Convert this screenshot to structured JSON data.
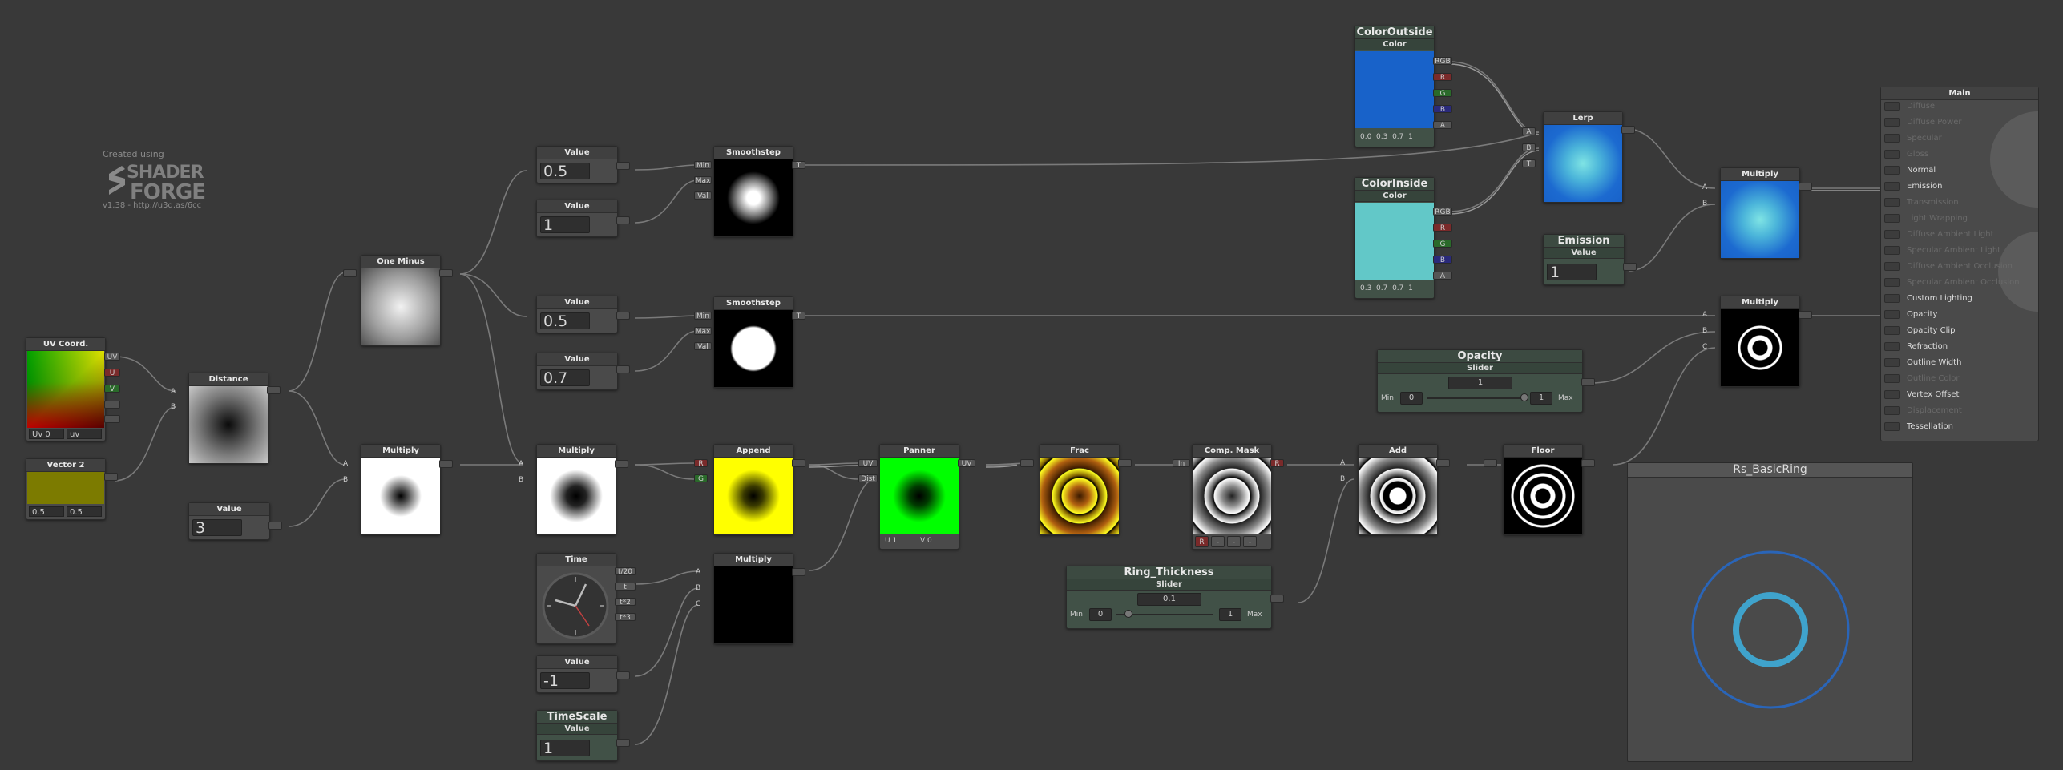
{
  "watermark": {
    "created": "Created using",
    "brand_line1": "SHADER",
    "brand_line2": "FORGE",
    "version": "v1.38 - http://u3d.as/6cc"
  },
  "nodes": {
    "uv": {
      "title": "UV Coord.",
      "ports": [
        "UV",
        "U",
        "V"
      ],
      "uv_label": "Uv 0",
      "uv_sel": "uv"
    },
    "vector2": {
      "title": "Vector 2",
      "x": "0.5",
      "y": "0.5"
    },
    "distance": {
      "title": "Distance",
      "in_a": "A",
      "in_b": "B"
    },
    "value3": {
      "title": "Value",
      "value": "3"
    },
    "oneminus": {
      "title": "One Minus"
    },
    "multiply1": {
      "title": "Multiply",
      "in_a": "A",
      "in_b": "B"
    },
    "value05a": {
      "title": "Value",
      "value": "0.5"
    },
    "value1a": {
      "title": "Value",
      "value": "1"
    },
    "value05b": {
      "title": "Value",
      "value": "0.5"
    },
    "value07": {
      "title": "Value",
      "value": "0.7"
    },
    "multiply2": {
      "title": "Multiply",
      "in_a": "A",
      "in_b": "B"
    },
    "time": {
      "title": "Time",
      "ports": [
        "t/20",
        "t",
        "t*2",
        "t*3"
      ]
    },
    "valueneg1": {
      "title": "Value",
      "value": "-1"
    },
    "timescale": {
      "title": "TimeScale",
      "sub": "Value",
      "value": "1"
    },
    "smooth1": {
      "title": "Smoothstep",
      "ins": [
        "Min",
        "Max",
        "Val"
      ],
      "out": "T"
    },
    "smooth2": {
      "title": "Smoothstep",
      "ins": [
        "Min",
        "Max",
        "Val"
      ],
      "out": "T"
    },
    "append": {
      "title": "Append",
      "ins": [
        "R",
        "G"
      ]
    },
    "multiply3": {
      "title": "Multiply",
      "ins": [
        "A",
        "B",
        "C"
      ]
    },
    "panner": {
      "title": "Panner",
      "ins": [
        "UV",
        "Dist"
      ],
      "out": "UV",
      "u": "U 1",
      "v": "V 0"
    },
    "frac": {
      "title": "Frac"
    },
    "compmask": {
      "title": "Comp. Mask",
      "in": "In",
      "out": "R",
      "chan": [
        "R",
        "-",
        "-",
        "-"
      ]
    },
    "add": {
      "title": "Add",
      "ins": [
        "A",
        "B"
      ]
    },
    "floor": {
      "title": "Floor"
    },
    "ringthick": {
      "title": "Ring_Thickness",
      "sub": "Slider",
      "value": "0.1",
      "min_label": "Min",
      "min": "0",
      "max": "1",
      "max_label": "Max"
    },
    "opacity": {
      "title": "Opacity",
      "sub": "Slider",
      "value": "1",
      "min_label": "Min",
      "min": "0",
      "max": "1",
      "max_label": "Max"
    },
    "coloroutside": {
      "title": "ColorOutside",
      "sub": "Color",
      "vals": "0.0  0.3  0.7  1",
      "ports": [
        "RGB",
        "R",
        "G",
        "B",
        "A"
      ],
      "color": "#1862c9"
    },
    "colorinside": {
      "title": "ColorInside",
      "sub": "Color",
      "vals": "0.3  0.7  0.7  1",
      "ports": [
        "RGB",
        "R",
        "G",
        "B",
        "A"
      ],
      "color": "#62c8c8"
    },
    "lerp": {
      "title": "Lerp",
      "ins": [
        "A",
        "B",
        "T"
      ]
    },
    "emission": {
      "title": "Emission",
      "sub": "Value",
      "value": "1"
    },
    "multiply4": {
      "title": "Multiply",
      "ins": [
        "A",
        "B"
      ]
    },
    "multiply5": {
      "title": "Multiply",
      "ins": [
        "A",
        "B",
        "C"
      ]
    }
  },
  "main": {
    "title": "Main",
    "rows": [
      {
        "label": "Diffuse",
        "on": false
      },
      {
        "label": "Diffuse Power",
        "on": false
      },
      {
        "label": "Specular",
        "on": false
      },
      {
        "label": "Gloss",
        "on": false
      },
      {
        "label": "Normal",
        "on": true
      },
      {
        "label": "Emission",
        "on": true
      },
      {
        "label": "Transmission",
        "on": false
      },
      {
        "label": "Light Wrapping",
        "on": false
      },
      {
        "label": "Diffuse Ambient Light",
        "on": false
      },
      {
        "label": "Specular Ambient Light",
        "on": false
      },
      {
        "label": "Diffuse Ambient Occlusion",
        "on": false
      },
      {
        "label": "Specular Ambient Occlusion",
        "on": false
      },
      {
        "label": "Custom Lighting",
        "on": true
      },
      {
        "label": "Opacity",
        "on": true
      },
      {
        "label": "Opacity Clip",
        "on": true
      },
      {
        "label": "Refraction",
        "on": true
      },
      {
        "label": "Outline Width",
        "on": true
      },
      {
        "label": "Outline Color",
        "on": false
      },
      {
        "label": "Vertex Offset",
        "on": true
      },
      {
        "label": "Displacement",
        "on": false
      },
      {
        "label": "Tessellation",
        "on": true
      }
    ]
  },
  "preview": {
    "title": "Rs_BasicRing",
    "outer_ring": "#2a65b8",
    "inner_ring": "#3fa3cc"
  }
}
